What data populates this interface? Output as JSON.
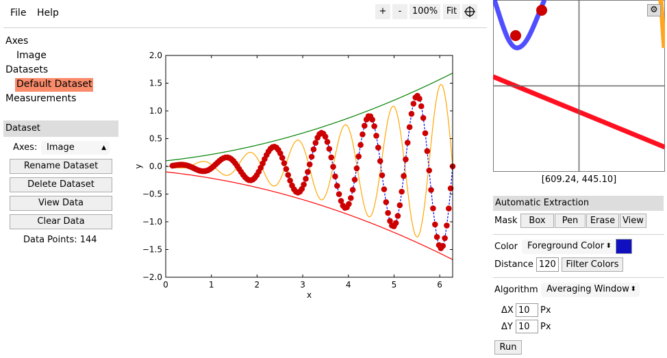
{
  "menu": {
    "file": "File",
    "help": "Help"
  },
  "zoom_toolbar": {
    "zoom_in": "+",
    "zoom_out": "-",
    "zoom_level": "100%",
    "fit": "Fit",
    "crosshair_icon": "crosshair-icon"
  },
  "tree": {
    "axes": "Axes",
    "axes_item": "Image",
    "datasets": "Datasets",
    "dataset_item": "Default Dataset",
    "measurements": "Measurements",
    "selected_color": "#f98b6b"
  },
  "dataset_panel": {
    "title": "Dataset",
    "axes_label": "Axes:",
    "axes_value": "Image",
    "rename": "Rename Dataset",
    "delete": "Delete Dataset",
    "view": "View Data",
    "clear": "Clear Data",
    "data_points_label": "Data Points:",
    "data_points": "144"
  },
  "plot": {
    "xlabel": "x",
    "ylabel": "y",
    "xticks": [
      "0",
      "1",
      "2",
      "3",
      "4",
      "5",
      "6"
    ],
    "yticks": [
      "2.0",
      "1.5",
      "1.0",
      "0.5",
      "0.0",
      "−0.5",
      "−1.0",
      "−1.5",
      "−2.0"
    ],
    "colors": {
      "upper": "#008000",
      "lower": "#ff0000",
      "orange": "#ffa500",
      "dots": "#cc0000",
      "trace": "#0000ff"
    }
  },
  "magnifier": {
    "coords": "[609.24, 445.10]",
    "settings_icon": "gear-icon"
  },
  "extraction": {
    "title": "Automatic Extraction",
    "mask_label": "Mask",
    "mask_buttons": [
      "Box",
      "Pen",
      "Erase",
      "View"
    ],
    "color_label": "Color",
    "color_mode": "Foreground Color",
    "color_value": "#1010c0",
    "distance_label": "Distance",
    "distance_value": "120",
    "filter_colors": "Filter Colors",
    "algorithm_label": "Algorithm",
    "algorithm_value": "Averaging Window",
    "dx_label": "ΔX",
    "dx_value": "10",
    "dx_unit": "Px",
    "dy_label": "ΔY",
    "dy_value": "10",
    "dy_unit": "Px",
    "run": "Run"
  }
}
